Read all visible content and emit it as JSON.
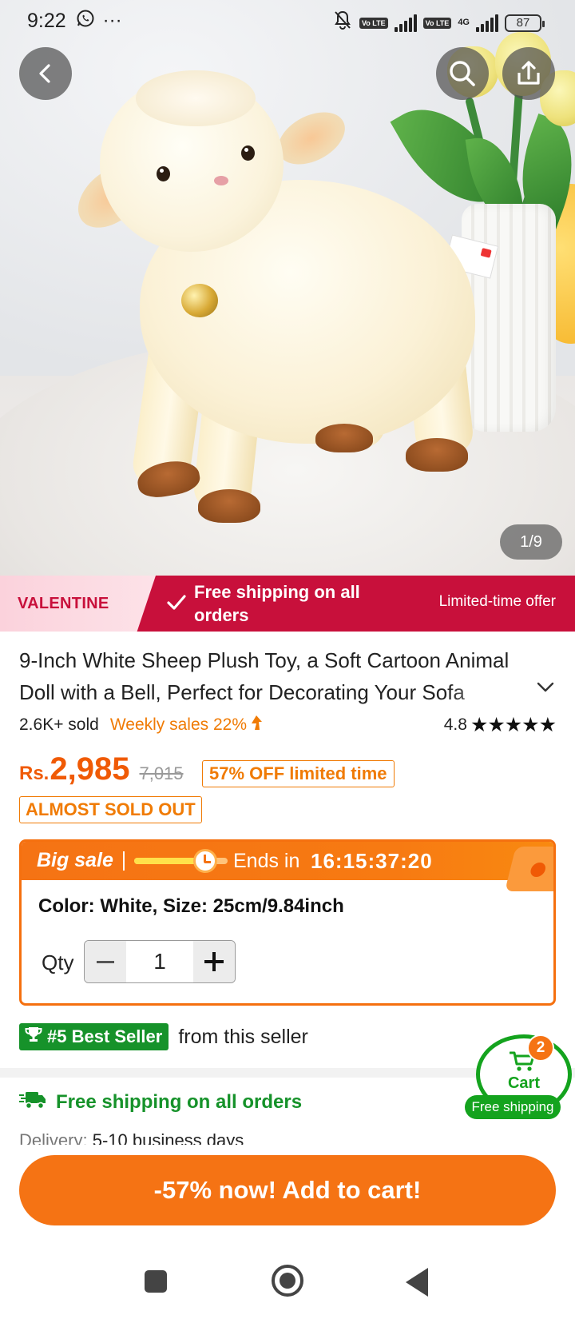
{
  "status_bar": {
    "time": "9:22",
    "overflow": "···",
    "battery": "87",
    "network": "4G",
    "volte": "Vo LTE"
  },
  "gallery": {
    "page_indicator": "1/9"
  },
  "promo_banner": {
    "tag": "VALENTINE",
    "message": "Free shipping on all orders",
    "limited": "Limited-time offer",
    "color": "#c8103b"
  },
  "product": {
    "title": "9-Inch White Sheep Plush Toy, a Soft Cartoon Animal Doll with a Bell, Perfect for Decorating Your Sofa",
    "sold": "2.6K+ sold",
    "weekly_sales": "Weekly sales 22%",
    "rating": "4.8",
    "stars": "★★★★★",
    "currency": "Rs.",
    "price": "2,985",
    "old_price": "7,015",
    "discount_badge": "57% OFF limited time",
    "stock_badge": "ALMOST SOLD OUT"
  },
  "big_sale": {
    "label": "Big sale",
    "ends_in": "Ends in",
    "timer": "16:15:37:20",
    "progress": 0.72,
    "variant": "Color: White, Size: 25cm/9.84inch",
    "qty_label": "Qty",
    "qty": "1"
  },
  "best_seller": {
    "badge": "#5 Best Seller",
    "from": "from this seller"
  },
  "shipping": {
    "title": "Free shipping on all orders",
    "delivery_label": "Delivery:",
    "delivery_value": "5-10 business days"
  },
  "cart": {
    "label": "Cart",
    "count": "2",
    "pill": "Free shipping"
  },
  "cta": {
    "add_to_cart": "-57% now! Add to cart!"
  },
  "colors": {
    "accent": "#f57314",
    "price": "#f05a05",
    "green": "#16922a"
  }
}
